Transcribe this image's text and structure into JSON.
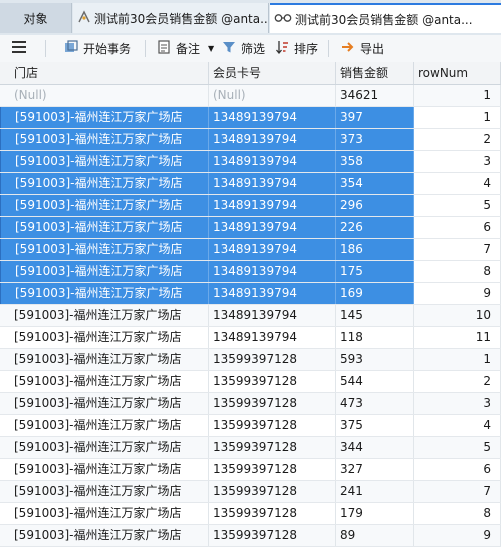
{
  "tabs": [
    {
      "label": "对象"
    },
    {
      "label": "测试前30会员销售金额 @anta...",
      "icon": "query-icon"
    },
    {
      "label": "测试前30会员销售金额 @anta...",
      "icon": "glasses-icon"
    }
  ],
  "toolbar": {
    "menu_icon": "hamburger-icon",
    "begin_transaction": "开始事务",
    "note": "备注",
    "filter": "筛选",
    "sort": "排序",
    "export": "导出"
  },
  "columns": [
    "门店",
    "会员卡号",
    "销售金额",
    "rowNum"
  ],
  "rows": [
    {
      "store": "(Null)",
      "card": "(Null)",
      "amount": "34621",
      "rownum": "1",
      "selected": false,
      "null_row": true
    },
    {
      "store": "[591003]-福州连江万家广场店",
      "card": "13489139794",
      "amount": "397",
      "rownum": "1",
      "selected": true
    },
    {
      "store": "[591003]-福州连江万家广场店",
      "card": "13489139794",
      "amount": "373",
      "rownum": "2",
      "selected": true
    },
    {
      "store": "[591003]-福州连江万家广场店",
      "card": "13489139794",
      "amount": "358",
      "rownum": "3",
      "selected": true
    },
    {
      "store": "[591003]-福州连江万家广场店",
      "card": "13489139794",
      "amount": "354",
      "rownum": "4",
      "selected": true
    },
    {
      "store": "[591003]-福州连江万家广场店",
      "card": "13489139794",
      "amount": "296",
      "rownum": "5",
      "selected": true
    },
    {
      "store": "[591003]-福州连江万家广场店",
      "card": "13489139794",
      "amount": "226",
      "rownum": "6",
      "selected": true
    },
    {
      "store": "[591003]-福州连江万家广场店",
      "card": "13489139794",
      "amount": "186",
      "rownum": "7",
      "selected": true
    },
    {
      "store": "[591003]-福州连江万家广场店",
      "card": "13489139794",
      "amount": "175",
      "rownum": "8",
      "selected": true
    },
    {
      "store": "[591003]-福州连江万家广场店",
      "card": "13489139794",
      "amount": "169",
      "rownum": "9",
      "selected": true,
      "current": true
    },
    {
      "store": "[591003]-福州连江万家广场店",
      "card": "13489139794",
      "amount": "145",
      "rownum": "10",
      "selected": false
    },
    {
      "store": "[591003]-福州连江万家广场店",
      "card": "13489139794",
      "amount": "118",
      "rownum": "11",
      "selected": false
    },
    {
      "store": "[591003]-福州连江万家广场店",
      "card": "13599397128",
      "amount": "593",
      "rownum": "1",
      "selected": false
    },
    {
      "store": "[591003]-福州连江万家广场店",
      "card": "13599397128",
      "amount": "544",
      "rownum": "2",
      "selected": false
    },
    {
      "store": "[591003]-福州连江万家广场店",
      "card": "13599397128",
      "amount": "473",
      "rownum": "3",
      "selected": false
    },
    {
      "store": "[591003]-福州连江万家广场店",
      "card": "13599397128",
      "amount": "375",
      "rownum": "4",
      "selected": false
    },
    {
      "store": "[591003]-福州连江万家广场店",
      "card": "13599397128",
      "amount": "344",
      "rownum": "5",
      "selected": false
    },
    {
      "store": "[591003]-福州连江万家广场店",
      "card": "13599397128",
      "amount": "327",
      "rownum": "6",
      "selected": false
    },
    {
      "store": "[591003]-福州连江万家广场店",
      "card": "13599397128",
      "amount": "241",
      "rownum": "7",
      "selected": false
    },
    {
      "store": "[591003]-福州连江万家广场店",
      "card": "13599397128",
      "amount": "179",
      "rownum": "8",
      "selected": false
    },
    {
      "store": "[591003]-福州连江万家广场店",
      "card": "13599397128",
      "amount": "89",
      "rownum": "9",
      "selected": false
    }
  ],
  "colors": {
    "selection": "#3d8fe3",
    "header_bg": "#f2f4f6",
    "tabbar_bg": "#dfe7ee"
  }
}
